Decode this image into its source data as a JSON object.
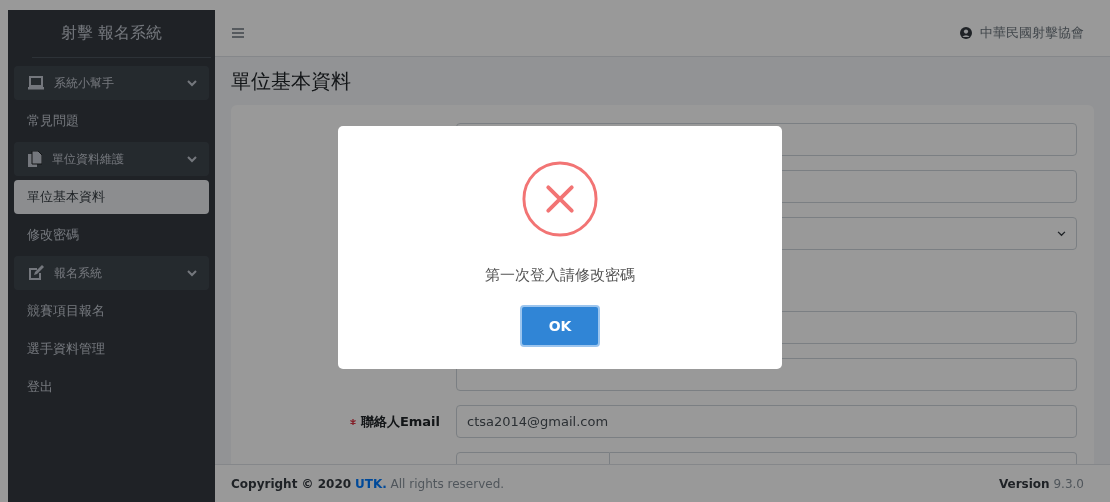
{
  "sidebar": {
    "brand": "射擊 報名系統",
    "groups": [
      {
        "label": "系統小幫手",
        "expanded": true,
        "items": [
          {
            "label": "常見問題",
            "selected": false
          }
        ]
      },
      {
        "label": "單位資料維護",
        "expanded": true,
        "items": [
          {
            "label": "單位基本資料",
            "selected": true
          },
          {
            "label": "修改密碼",
            "selected": false
          }
        ]
      },
      {
        "label": "報名系統",
        "expanded": true,
        "items": [
          {
            "label": "競賽項目報名",
            "selected": false
          },
          {
            "label": "選手資料管理",
            "selected": false
          },
          {
            "label": "登出",
            "selected": false
          }
        ]
      }
    ]
  },
  "topbar": {
    "user": "中華民國射擊協會"
  },
  "page_title": "單位基本資料",
  "form": {
    "rows": [
      {
        "kind": "input"
      },
      {
        "kind": "input"
      },
      {
        "kind": "select"
      },
      {
        "kind": "blank"
      },
      {
        "kind": "input"
      },
      {
        "kind": "input"
      },
      {
        "kind": "input",
        "label": "聯絡人Email",
        "required": true,
        "value": "ctsa2014@gmail.com"
      },
      {
        "kind": "split"
      }
    ]
  },
  "footer": {
    "copyright": "Copyright © 2020",
    "link": "UTK.",
    "rights": "All rights reserved.",
    "version_label": "Version",
    "version": "9.3.0"
  },
  "dialog": {
    "kind": "error",
    "message": "第一次登入請修改密碼",
    "button": "OK"
  }
}
